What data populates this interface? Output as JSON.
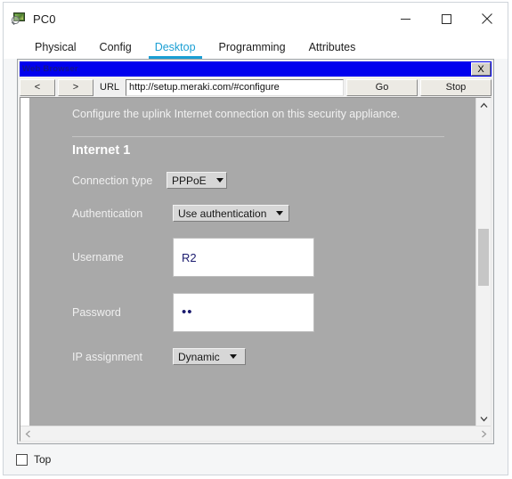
{
  "window": {
    "title": "PC0",
    "icon": "pc-device-icon",
    "controls": {
      "minimize": "minimize-icon",
      "maximize": "maximize-icon",
      "close": "close-icon"
    }
  },
  "tabs": [
    {
      "label": "Physical",
      "active": false
    },
    {
      "label": "Config",
      "active": false
    },
    {
      "label": "Desktop",
      "active": true
    },
    {
      "label": "Programming",
      "active": false
    },
    {
      "label": "Attributes",
      "active": false
    }
  ],
  "browser": {
    "title": "Web Browser",
    "close_label": "X",
    "toolbar": {
      "back_label": "<",
      "forward_label": ">",
      "url_label": "URL",
      "url_value": "http://setup.meraki.com/#configure",
      "go_label": "Go",
      "stop_label": "Stop"
    }
  },
  "page": {
    "intro": "Configure the uplink Internet connection on this security appliance.",
    "section_title": "Internet 1",
    "fields": {
      "connection_type": {
        "label": "Connection type",
        "value": "PPPoE"
      },
      "authentication": {
        "label": "Authentication",
        "value": "Use authentication"
      },
      "username": {
        "label": "Username",
        "value": "R2"
      },
      "password": {
        "label": "Password",
        "value": "••"
      },
      "ip_assignment": {
        "label": "IP assignment",
        "value": "Dynamic"
      }
    }
  },
  "bottom": {
    "top_checkbox_label": "Top",
    "top_checkbox_checked": false
  },
  "colors": {
    "accent": "#1a9fd4",
    "browser_titlebar": "#0000ee",
    "page_background": "#a9a9a9",
    "field_text": "#1a1a6e"
  }
}
